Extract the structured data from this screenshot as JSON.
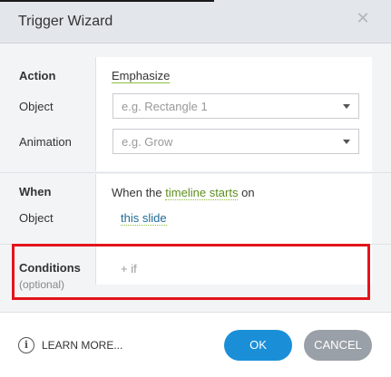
{
  "dialog": {
    "title": "Trigger Wizard"
  },
  "action_section": {
    "action_label": "Action",
    "action_value": "Emphasize",
    "object_label": "Object",
    "object_placeholder": "e.g. Rectangle 1",
    "animation_label": "Animation",
    "animation_placeholder": "e.g. Grow"
  },
  "when_section": {
    "when_label": "When",
    "sentence_prefix": "When the",
    "event_link": "timeline starts",
    "sentence_suffix": "on",
    "object_label": "Object",
    "object_link": "this slide"
  },
  "conditions_section": {
    "label": "Conditions",
    "optional": "(optional)",
    "add_if": "+ if"
  },
  "footer": {
    "learn_more": "LEARN MORE...",
    "ok": "OK",
    "cancel": "CANCEL"
  },
  "colors": {
    "accent": "#1a8fd8",
    "highlight": "#e3141b",
    "cancel": "#9aa0a7"
  }
}
